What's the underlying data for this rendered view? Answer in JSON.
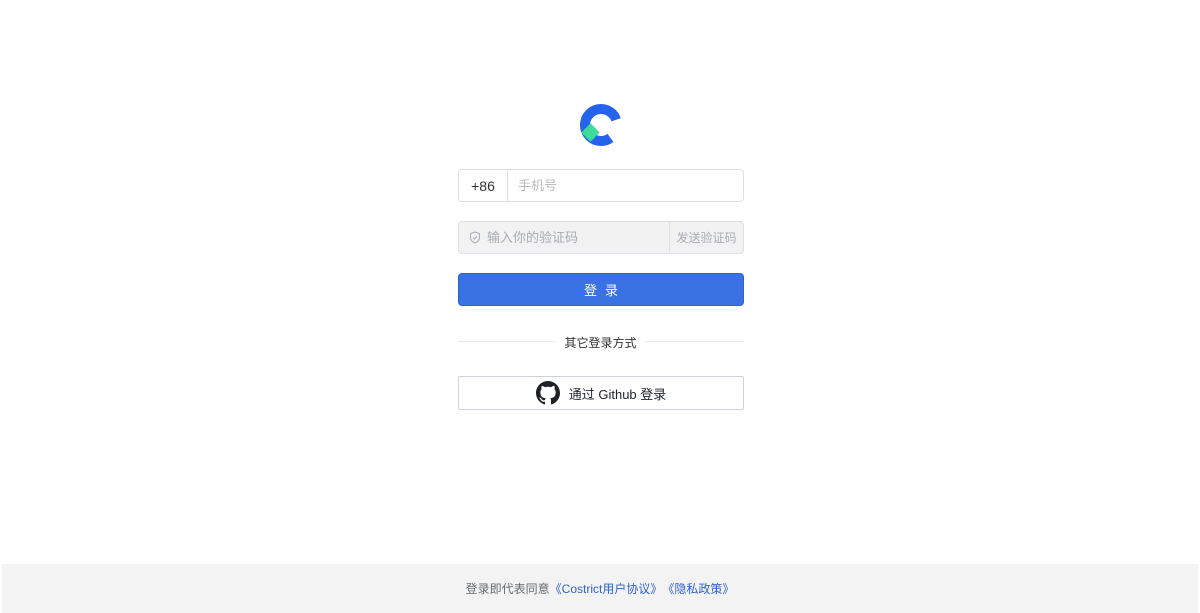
{
  "logo": {
    "icon": "brand-logo-icon",
    "primary_color": "#2563eb",
    "accent_color": "#3ddc97"
  },
  "phone": {
    "country_code": "+86",
    "placeholder": "手机号",
    "value": ""
  },
  "verification": {
    "icon": "shield-check-icon",
    "placeholder": "输入你的验证码",
    "value": "",
    "send_label": "发送验证码"
  },
  "login_button": {
    "label": "登录",
    "color": "#3a71e3"
  },
  "other_login": {
    "divider_label": "其它登录方式"
  },
  "github": {
    "icon": "github-icon",
    "label": "通过 Github 登录"
  },
  "footer": {
    "prefix": "登录即代表同意",
    "user_agreement": "《Costrict用户协议》",
    "privacy_policy": "《隐私政策》",
    "link_color": "#2f62cf"
  }
}
